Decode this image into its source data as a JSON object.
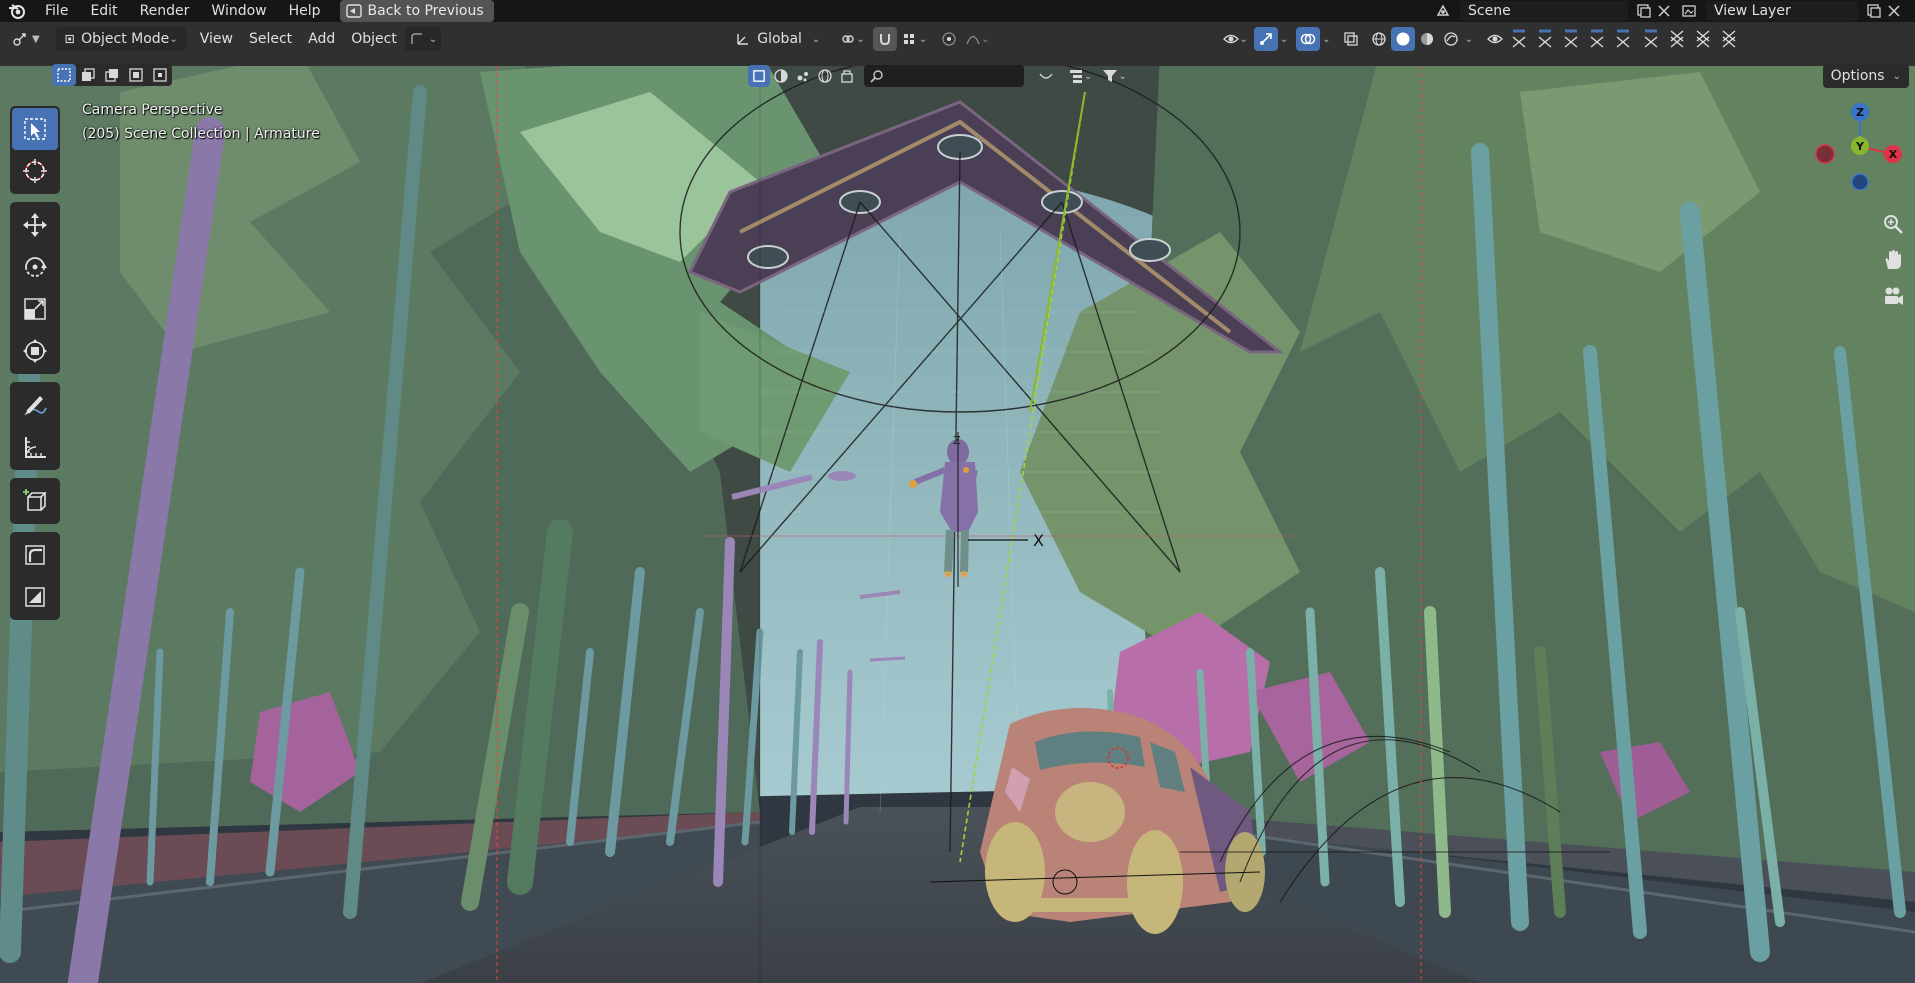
{
  "menu": {
    "items": [
      "File",
      "Edit",
      "Render",
      "Window",
      "Help"
    ],
    "back_button": "Back to Previous"
  },
  "scene": {
    "name": "Scene",
    "view_layer": "View Layer"
  },
  "header": {
    "mode": "Object Mode",
    "menus": [
      "View",
      "Select",
      "Add",
      "Object"
    ],
    "transform_orientation": "Global"
  },
  "viewport": {
    "camera_label": "Camera Perspective",
    "collection_label": "(205) Scene Collection | Armature",
    "options_label": "Options",
    "search_placeholder": ""
  },
  "gizmo": {
    "z": "Z",
    "y": "Y",
    "x": "X"
  },
  "icons": {
    "logo": "blender-logo-icon",
    "back": "back-to-previous-icon",
    "tools": [
      "select-box-icon",
      "cursor-icon",
      "move-icon",
      "rotate-icon",
      "scale-icon",
      "transform-icon",
      "annotate-icon",
      "measure-icon",
      "add-cube-icon",
      "shear-icon",
      "extrude-icon"
    ]
  },
  "colors": {
    "accent": "#4772b3",
    "axis_x": "#e0324a",
    "axis_y": "#8bb82c",
    "axis_z": "#3a74c9",
    "sky": "#8fb9bf"
  }
}
